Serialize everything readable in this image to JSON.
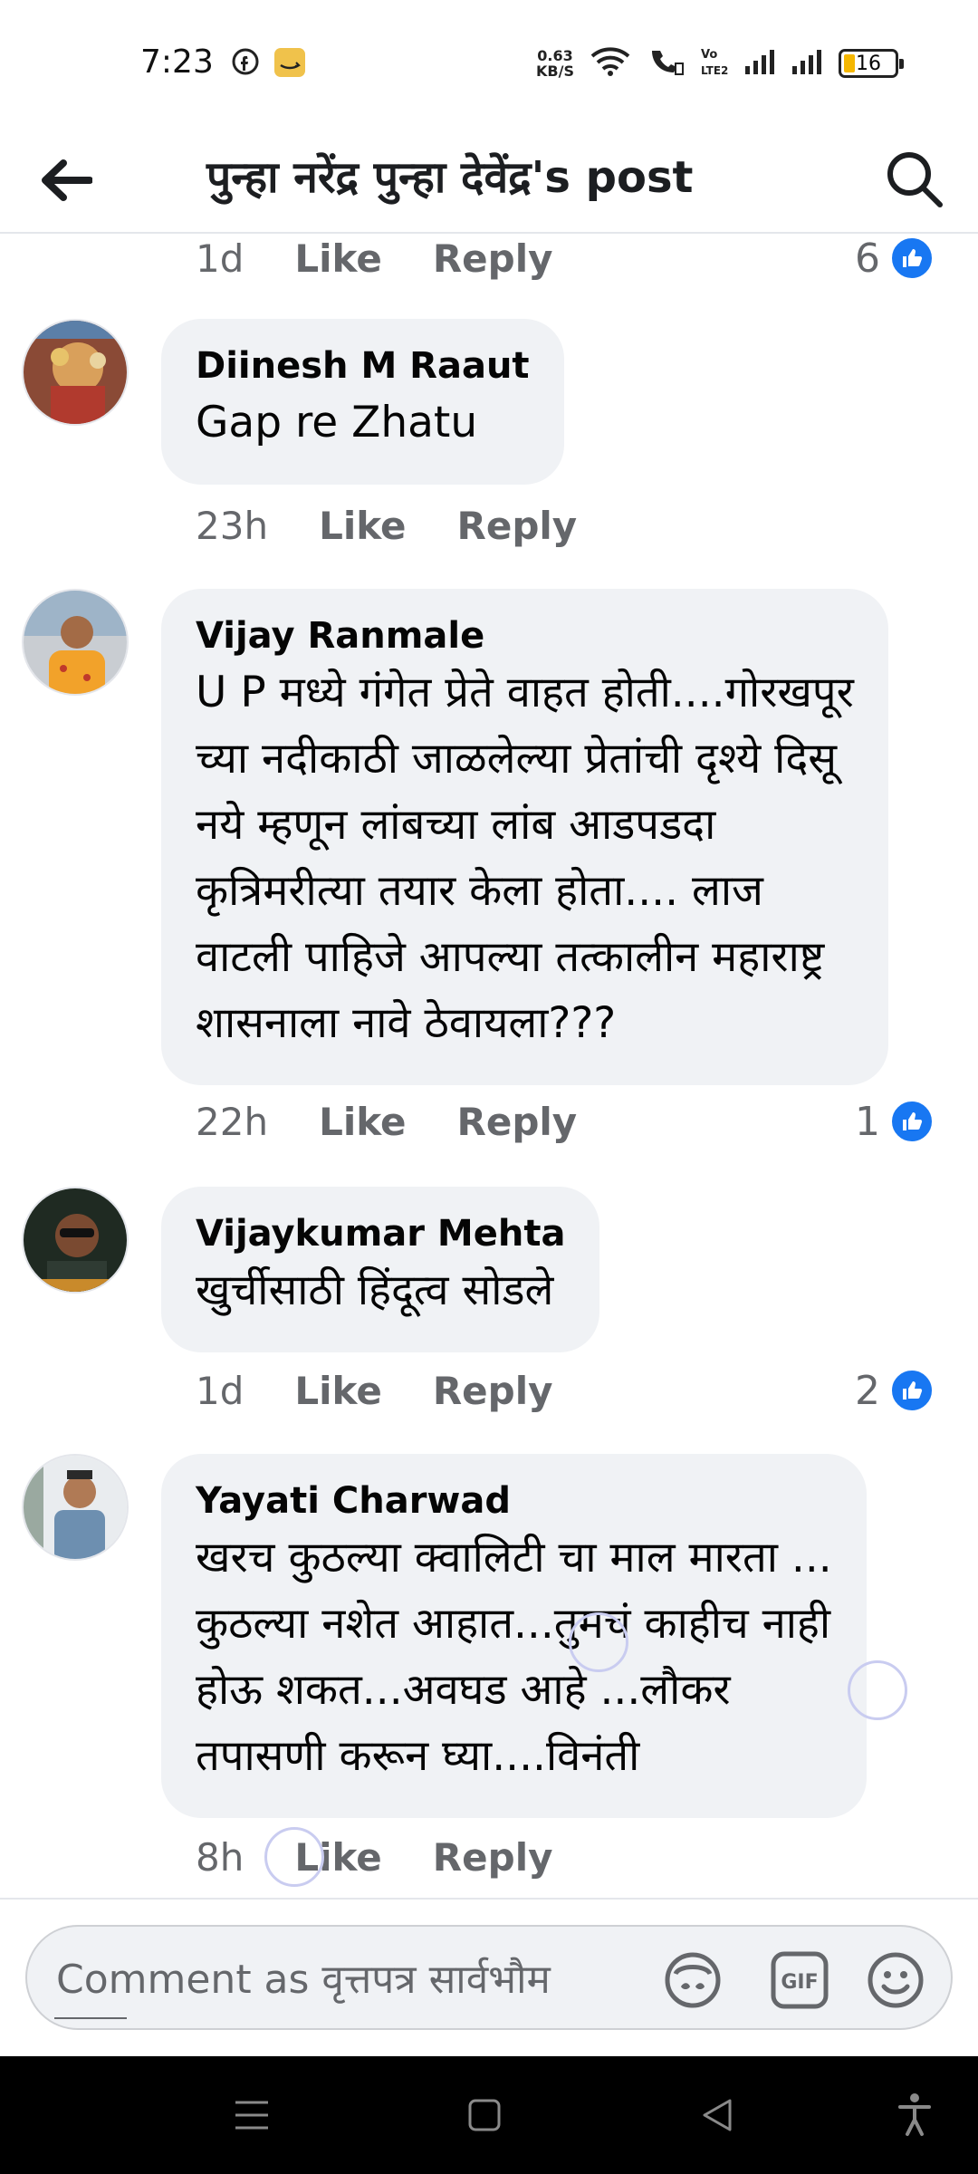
{
  "status_bar": {
    "time": "7:23",
    "net_speed_value": "0.63",
    "net_speed_unit": "KB/S",
    "battery": "16"
  },
  "header": {
    "title": "पुन्हा नरेंद्र पुन्हा देवेंद्र's post"
  },
  "actions": {
    "like": "Like",
    "reply": "Reply"
  },
  "prev_comment_meta": {
    "time": "1d",
    "like_count": "6"
  },
  "comments": [
    {
      "author": "Diinesh M Raaut",
      "lines": [
        "Gap re Zhatu"
      ],
      "time": "23h",
      "like_count": ""
    },
    {
      "author": "Vijay Ranmale",
      "lines": [
        "U P मध्ये गंगेत प्रेते वाहत होती....गोरखपूर",
        "च्या नदीकाठी जाळलेल्या प्रेतांची दृश्ये दिसू",
        "नये म्हणून लांबच्या लांब आडपडदा",
        "कृत्रिमरीत्या तयार केला होता.... लाज",
        "वाटली पाहिजे आपल्या तत्कालीन महाराष्ट्र",
        "शासनाला नावे ठेवायला???"
      ],
      "time": "22h",
      "like_count": "1"
    },
    {
      "author": "Vijaykumar Mehta",
      "lines": [
        "खुर्चीसाठी हिंदूत्व सोडले"
      ],
      "time": "1d",
      "like_count": "2"
    },
    {
      "author": "Yayati Charwad",
      "lines": [
        "खरच कुठल्या क्वालिटी चा माल मारता ...",
        "कुठल्या नशेत आहात...तुमचं काहीच नाही",
        "होऊ शकत...अवघड आहे ...लौकर",
        "तपासणी करून घ्या....विनंती"
      ],
      "time": "8h",
      "like_count": ""
    }
  ],
  "composer": {
    "placeholder": "Comment as वृत्तपत्र सार्वभौम"
  },
  "colors": {
    "accent": "#1877f2",
    "bubble": "#f0f2f5",
    "meta_text": "#65676b"
  }
}
